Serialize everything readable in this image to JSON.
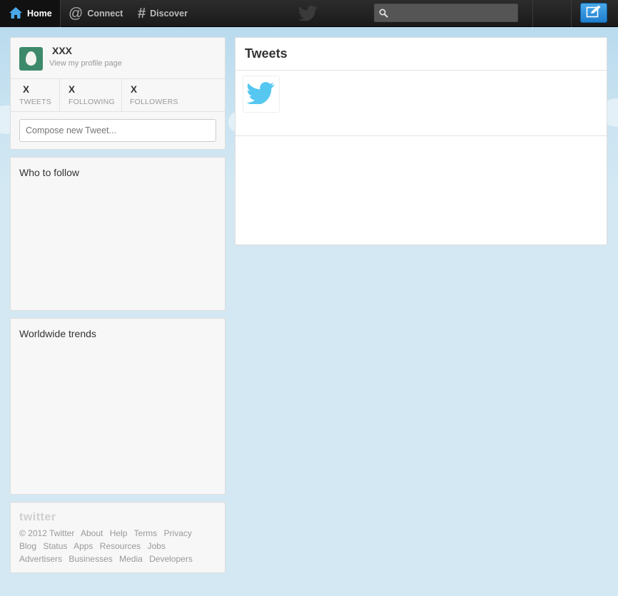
{
  "nav": {
    "home_label": "Home",
    "connect_label": "Connect",
    "discover_label": "Discover",
    "search_placeholder": "",
    "home_icon": "house-icon",
    "connect_icon": "at-icon",
    "discover_icon": "hash-icon",
    "compose_icon": "compose-pencil-icon"
  },
  "profile": {
    "name": "XXX",
    "link": "View my profile page",
    "stats": [
      {
        "num": "X",
        "label": "TWEETS"
      },
      {
        "num": "X",
        "label": "FOLLOWING"
      },
      {
        "num": "X",
        "label": "FOLLOWERS"
      }
    ],
    "compose_placeholder": "Compose new Tweet..."
  },
  "who_to_follow": {
    "title": "Who to follow"
  },
  "trends": {
    "title": "Worldwide trends"
  },
  "footer": {
    "logo": "twitter",
    "row1": [
      "© 2012 Twitter",
      "About",
      "Help",
      "Terms",
      "Privacy"
    ],
    "row2": [
      "Blog",
      "Status",
      "Apps",
      "Resources",
      "Jobs"
    ],
    "row3": [
      "Advertisers",
      "Businesses",
      "Media",
      "Developers"
    ]
  },
  "tweets": {
    "title": "Tweets"
  },
  "colors": {
    "accent": "#1f7ecf",
    "bird": "#55c7f0",
    "topbar": "#222222",
    "background": "#c0deed"
  }
}
